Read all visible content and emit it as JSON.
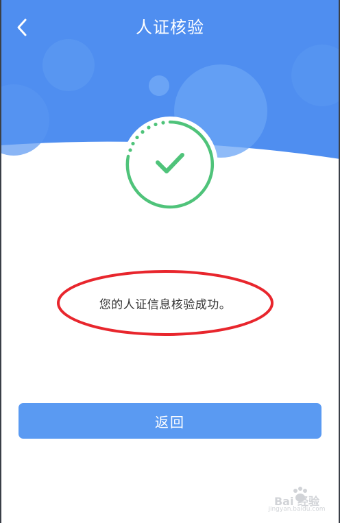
{
  "header": {
    "title": "人证核验",
    "back_icon": "chevron-left-icon",
    "background_color": "#4f8ef0"
  },
  "status": {
    "icon": "check-circle-icon",
    "color": "#4fc37a",
    "message": "您的人证信息核验成功。",
    "highlight_color": "#e8262d"
  },
  "actions": {
    "return_label": "返回",
    "button_color": "#5a9af2"
  },
  "watermark": {
    "brand": "Bai 经验",
    "url": "jingyan.baidu.com"
  }
}
